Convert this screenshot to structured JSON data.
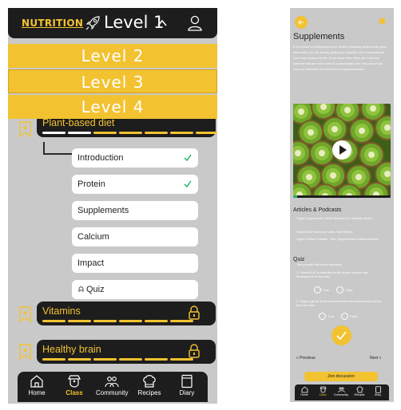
{
  "header": {
    "brand": "NUTRITION",
    "current_level": "Level 1",
    "levels": [
      "Level 2",
      "Level 3",
      "Level 4"
    ],
    "highlighted_level": "Level 3"
  },
  "modules": {
    "plant_based": {
      "title": "Plant-based diet",
      "progress_done": 2,
      "progress_total": 7
    },
    "vitamins": {
      "title": "Vitamins",
      "locked": true
    },
    "healthy_brain": {
      "title": "Healthy brain",
      "locked": true
    }
  },
  "lessons": [
    {
      "label": "Introduction",
      "done": true
    },
    {
      "label": "Protein",
      "done": true
    },
    {
      "label": "Supplements",
      "done": false
    },
    {
      "label": "Calcium",
      "done": false
    },
    {
      "label": "Impact",
      "done": false
    },
    {
      "label": "Quiz",
      "done": false
    }
  ],
  "nav": [
    {
      "label": "Home",
      "icon": "home-icon"
    },
    {
      "label": "Class",
      "icon": "class-icon",
      "active": true
    },
    {
      "label": "Community",
      "icon": "community-icon"
    },
    {
      "label": "Recipes",
      "icon": "recipes-icon"
    },
    {
      "label": "Diary",
      "icon": "diary-icon"
    }
  ],
  "detail": {
    "title": "Supplements",
    "intro": "If you follow a nutritionally sound, health promoting whole foods plant-based diet, you are already getting the majority of the micronutrients your body needs to thrive. At the same time, there are a few key nutrients that are hard to find in a plant-based diet. Your doctor can help you determine the best form of supplementation.",
    "video_progress": 0.04,
    "articles_title": "Articles & Podcasts",
    "articles": [
      "Vegan Supplements: What Vitamins Do I Actually Need?",
      "Vitamin B12 Overview: Uses, Side Effects",
      "Vegan Thinker Podcast - D12, Supplements & Micronutrients"
    ],
    "quiz_title": "Quiz",
    "quiz_subtitle": "Test yourself with these questions",
    "questions": [
      "1. Vitamin B12 is essential for the proper function and development of the brain.",
      "2. Vegans get all of the micronutrients their body needs to thrive from their diet."
    ],
    "true_label": "True",
    "false_label": "False",
    "prev_label": "« Previous",
    "next_label": "Next »",
    "join_label": "Join discussion"
  },
  "colors": {
    "accent": "#f2c230",
    "dark": "#1d1d1d",
    "background": "#c9c9c9",
    "done_check": "#2bb46a"
  }
}
